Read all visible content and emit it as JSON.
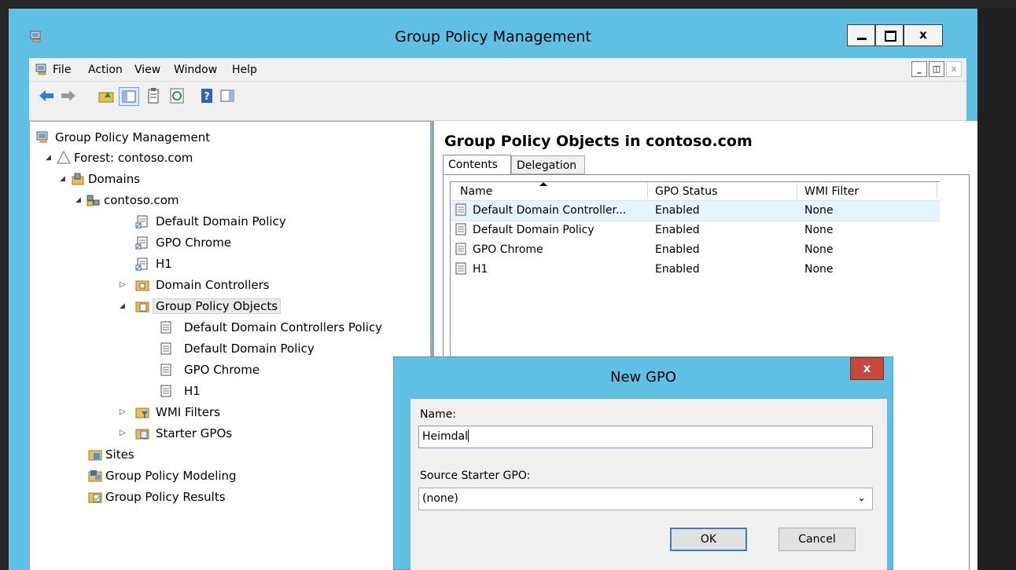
{
  "window": {
    "title": "Group Policy Management"
  },
  "menu": [
    "File",
    "Action",
    "View",
    "Window",
    "Help"
  ],
  "toolbar_icons": [
    "back-arrow-icon",
    "forward-arrow-icon",
    "up-folder-icon",
    "show-hide-tree-icon",
    "properties-icon",
    "refresh-icon",
    "help-icon",
    "show-action-pane-icon"
  ],
  "tree": [
    {
      "label": "Group Policy Management",
      "icon": "gpm-icon"
    },
    {
      "label": "Forest: contoso.com",
      "icon": "forest-icon"
    },
    {
      "label": "Domains",
      "icon": "domains-icon"
    },
    {
      "label": "contoso.com",
      "icon": "domain-icon"
    },
    {
      "label": "Default Domain Policy",
      "icon": "gpo-link-icon"
    },
    {
      "label": "GPO Chrome",
      "icon": "gpo-link-icon"
    },
    {
      "label": "H1",
      "icon": "gpo-link-icon"
    },
    {
      "label": "Domain Controllers",
      "icon": "ou-folder-icon"
    },
    {
      "label": "Group Policy Objects",
      "icon": "gpo-folder-icon"
    },
    {
      "label": "Default Domain Controllers Policy",
      "icon": "gpo-icon"
    },
    {
      "label": "Default Domain Policy",
      "icon": "gpo-icon"
    },
    {
      "label": "GPO Chrome",
      "icon": "gpo-icon"
    },
    {
      "label": "H1",
      "icon": "gpo-icon"
    },
    {
      "label": "WMI Filters",
      "icon": "wmi-folder-icon"
    },
    {
      "label": "Starter GPOs",
      "icon": "starter-folder-icon"
    },
    {
      "label": "Sites",
      "icon": "sites-icon"
    },
    {
      "label": "Group Policy Modeling",
      "icon": "modeling-icon"
    },
    {
      "label": "Group Policy Results",
      "icon": "results-icon"
    }
  ],
  "right": {
    "title": "Group Policy Objects in contoso.com",
    "tabs": [
      "Contents",
      "Delegation"
    ],
    "columns": [
      "Name",
      "GPO Status",
      "WMI Filter"
    ],
    "rows": [
      {
        "name": "Default Domain Controller...",
        "status": "Enabled",
        "wmi": "None"
      },
      {
        "name": "Default Domain Policy",
        "status": "Enabled",
        "wmi": "None"
      },
      {
        "name": "GPO Chrome",
        "status": "Enabled",
        "wmi": "None"
      },
      {
        "name": "H1",
        "status": "Enabled",
        "wmi": "None"
      }
    ]
  },
  "dialog": {
    "title": "New GPO",
    "close_label": "x",
    "name_label": "Name:",
    "name_value": "Heimdal",
    "source_label": "Source Starter GPO:",
    "source_value": "(none)",
    "ok_label": "OK",
    "cancel_label": "Cancel"
  }
}
